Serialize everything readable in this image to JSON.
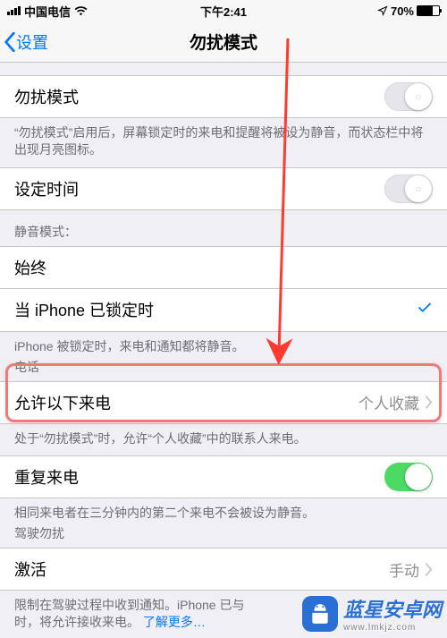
{
  "status": {
    "carrier": "中国电信",
    "time": "下午2:41",
    "battery_pct": "70%"
  },
  "nav": {
    "back_label": "设置",
    "title": "勿扰模式"
  },
  "rows": {
    "dnd_label": "勿扰模式",
    "dnd_footer": "“勿扰模式”启用后，屏幕锁定时的来电和提醒将被设为静音，而状态栏中将出现月亮图标。",
    "schedule_label": "设定时间",
    "silence_header": "静音模式：",
    "always_label": "始终",
    "locked_label": "当 iPhone 已锁定时",
    "locked_footer": "iPhone 被锁定时，来电和通知都将静音。",
    "phone_header": "电话",
    "allow_label": "允许以下来电",
    "allow_value": "个人收藏",
    "allow_footer": "处于“勿扰模式”时，允许“个人收藏”中的联系人来电。",
    "repeat_label": "重复来电",
    "repeat_footer": "相同来电者在三分钟内的第二个来电不会被设为静音。",
    "driving_header": "驾驶勿扰",
    "activate_label": "激活",
    "activate_value": "手动",
    "activate_footer_1": "限制在驾驶过程中收到通知。iPhone 已与",
    "activate_footer_2": "时，将允许接收来电。",
    "learn_more": "了解更多…"
  },
  "watermark": {
    "text": "蓝星安卓网",
    "url": "www.lmkjz.com"
  }
}
